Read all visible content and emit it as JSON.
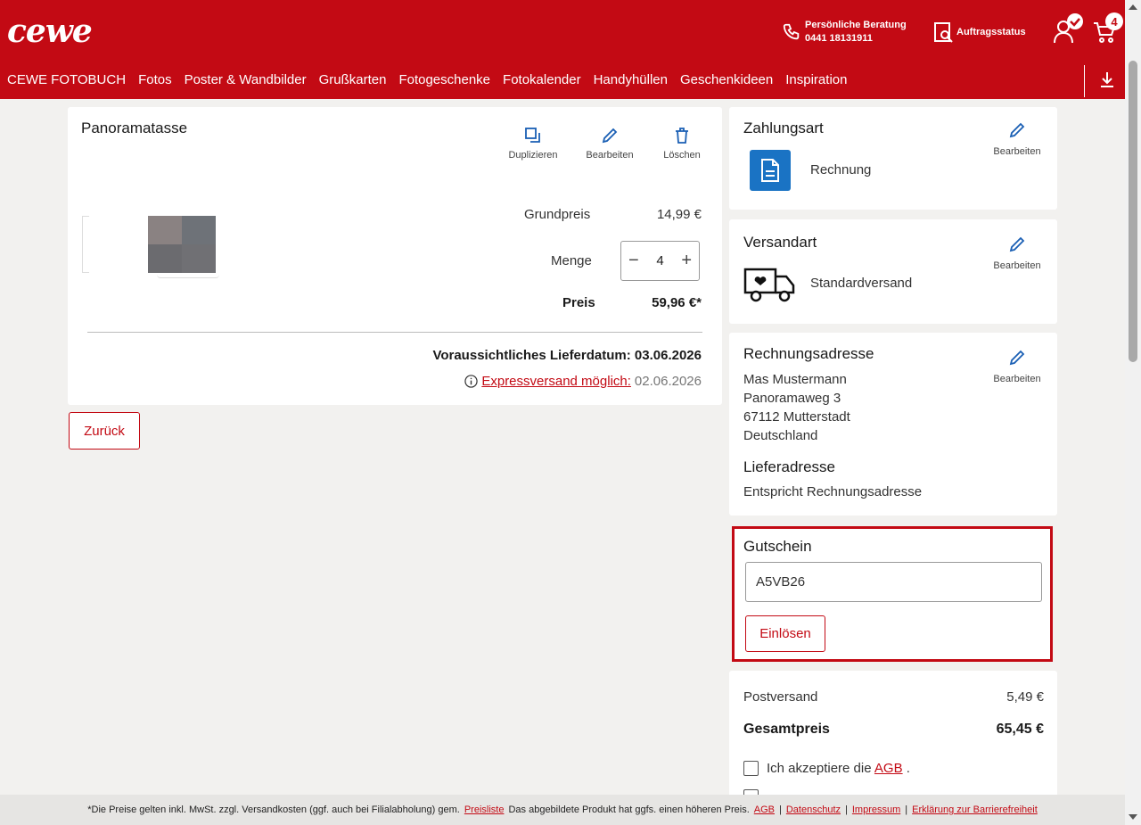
{
  "header": {
    "logo": "cewe",
    "consult_title": "Persönliche Beratung",
    "consult_phone": "0441 18131911",
    "order_status": "Auftragsstatus",
    "cart_count": "4"
  },
  "nav": [
    "CEWE FOTOBUCH",
    "Fotos",
    "Poster & Wandbilder",
    "Grußkarten",
    "Fotogeschenke",
    "Fotokalender",
    "Handyhüllen",
    "Geschenkideen",
    "Inspiration"
  ],
  "product": {
    "name": "Panoramatasse",
    "actions": {
      "duplicate": "Duplizieren",
      "edit": "Bearbeiten",
      "delete": "Löschen"
    },
    "base_price_label": "Grundpreis",
    "base_price": "14,99 €",
    "qty_label": "Menge",
    "qty": "4",
    "price_label": "Preis",
    "price": "59,96 €*",
    "delivery_label": "Voraussichtliches Lieferdatum:",
    "delivery_date": "03.06.2026",
    "express_link": "Expressversand möglich:",
    "express_date": "02.06.2026"
  },
  "back_button": "Zurück",
  "payment": {
    "title": "Zahlungsart",
    "method": "Rechnung",
    "edit": "Bearbeiten"
  },
  "shipping": {
    "title": "Versandart",
    "method": "Standardversand",
    "edit": "Bearbeiten"
  },
  "billing": {
    "title": "Rechnungsadresse",
    "edit": "Bearbeiten",
    "lines": [
      "Mas Mustermann",
      "Panoramaweg 3",
      "67112 Mutterstadt",
      "Deutschland"
    ],
    "delivery_title": "Lieferadresse",
    "delivery_text": "Entspricht Rechnungsadresse"
  },
  "voucher": {
    "title": "Gutschein",
    "value": "A5VB26",
    "button": "Einlösen"
  },
  "summary": {
    "shipping_label": "Postversand",
    "shipping_value": "5,49 €",
    "total_label": "Gesamtpreis",
    "total_value": "65,45 €",
    "agb_prefix": "Ich akzeptiere die",
    "agb_link": "AGB",
    "agb_suffix": "."
  },
  "footer": {
    "text1": "*Die Preise gelten inkl. MwSt. zzgl. Versandkosten (ggf. auch bei Filialabholung) gem.",
    "link_price": "Preisliste",
    "text2": "Das abgebildete Produkt hat ggfs. einen höheren Preis.",
    "link_agb": "AGB",
    "link_privacy": "Datenschutz",
    "link_imprint": "Impressum",
    "link_access": "Erklärung zur Barrierefreiheit"
  },
  "colors": {
    "brand": "#c30a14",
    "background": "#f2f1ef",
    "payment_icon": "#1a73c4"
  }
}
